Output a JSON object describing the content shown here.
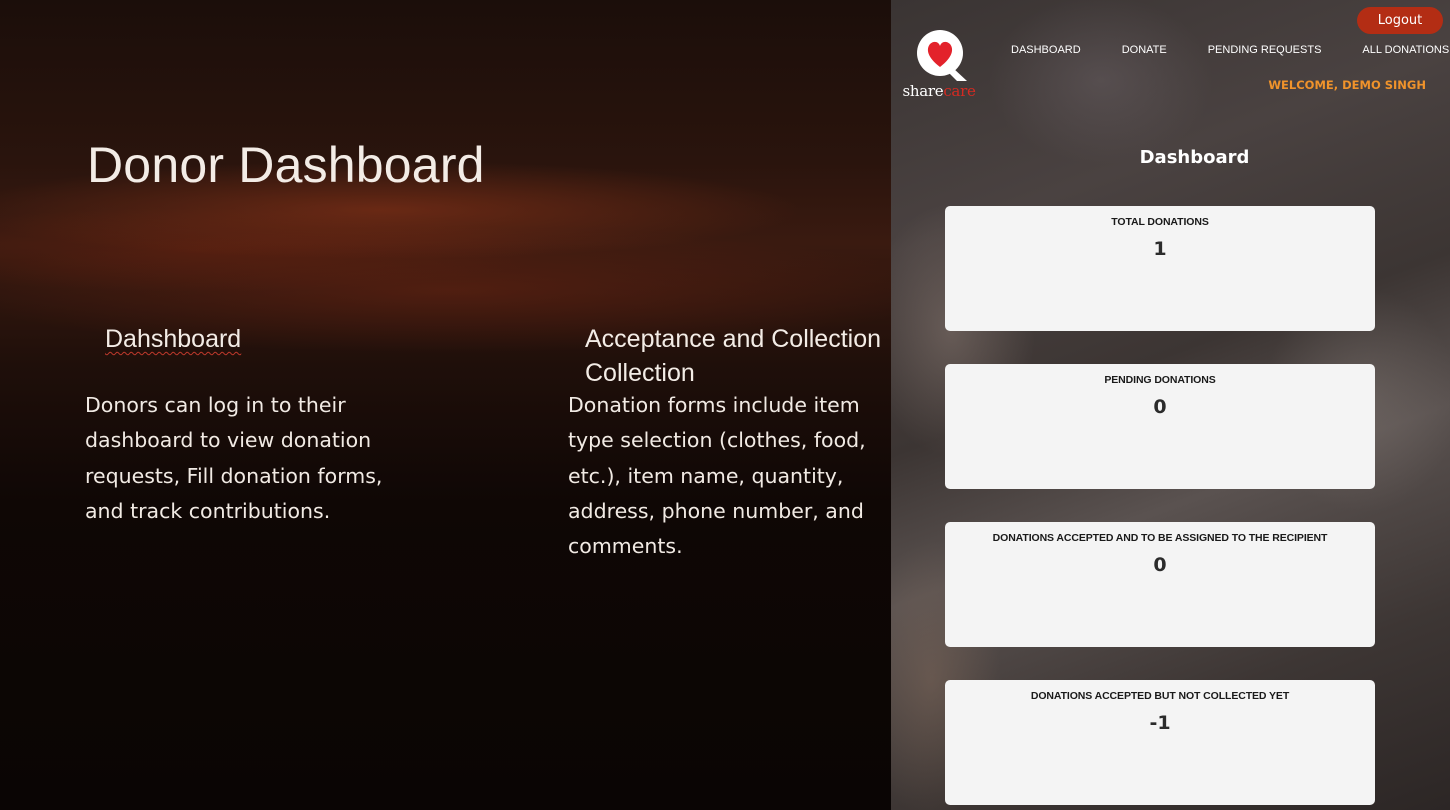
{
  "slide": {
    "title": "Donor Dashboard",
    "col1_heading": "Dahshboard",
    "col1_body": "Donors can log in to their dashboard to view donation requests, Fill donation forms, and track contributions.",
    "col2_heading": "Acceptance and Collection Collection",
    "col2_body": "Donation forms include item type selection (clothes, food, etc.), item name, quantity, address, phone number, and comments."
  },
  "app": {
    "logo": {
      "word1": "share",
      "word2": "care",
      "icon": "heart-search-icon"
    },
    "logout_label": "Logout",
    "nav": [
      {
        "label": "DASHBOARD"
      },
      {
        "label": "DONATE"
      },
      {
        "label": "PENDING REQUESTS"
      },
      {
        "label": "ALL DONATIONS"
      }
    ],
    "welcome": "WELCOME, DEMO SINGH",
    "page_heading": "Dashboard",
    "cards": [
      {
        "label": "TOTAL DONATIONS",
        "value": "1"
      },
      {
        "label": "PENDING DONATIONS",
        "value": "0"
      },
      {
        "label": "DONATIONS ACCEPTED AND TO BE ASSIGNED TO THE RECIPIENT",
        "value": "0"
      },
      {
        "label": "DONATIONS ACCEPTED BUT NOT COLLECTED YET",
        "value": "-1"
      }
    ],
    "colors": {
      "accent_red": "#b32d14",
      "welcome_orange": "#f0932b",
      "card_bg": "#f4f4f4"
    }
  }
}
